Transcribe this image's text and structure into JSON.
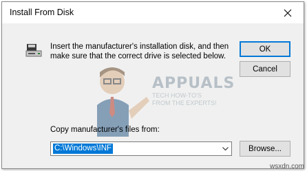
{
  "window": {
    "title": "Install From Disk",
    "close_icon": "close-icon"
  },
  "message": "Insert the manufacturer's installation disk, and then make sure that the correct drive is selected below.",
  "buttons": {
    "ok": "OK",
    "cancel": "Cancel",
    "browse": "Browse..."
  },
  "copy_from": {
    "label": "Copy manufacturer's files from:",
    "value": "C:\\Windows\\INF"
  },
  "watermark": {
    "title": "APPUALS",
    "tagline": "TECH HOW-TO'S FROM THE EXPERTS!"
  },
  "site": "wsxdn.com",
  "colors": {
    "accent": "#0078d7",
    "dialog_bg": "#f0f0f0",
    "button_bg": "#e1e1e1"
  }
}
